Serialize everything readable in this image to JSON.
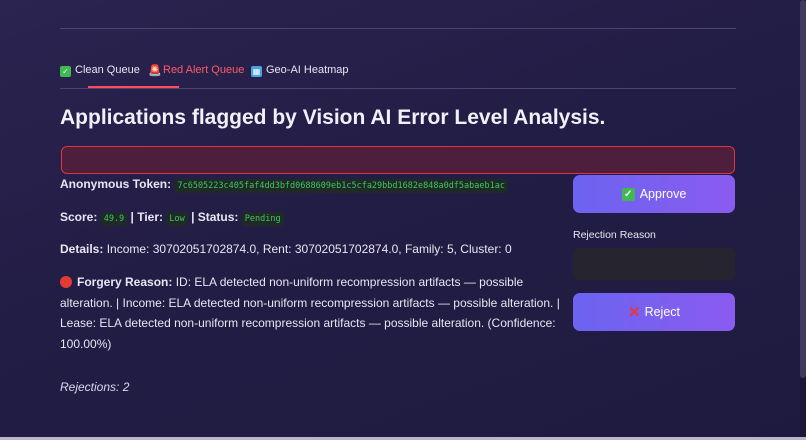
{
  "tabs": [
    {
      "label": "Clean Queue",
      "icon": "check-icon",
      "active": false
    },
    {
      "label": "Red Alert Queue",
      "icon": "siren-icon",
      "active": true
    },
    {
      "label": "Geo-AI Heatmap",
      "icon": "map-icon",
      "active": false
    }
  ],
  "page": {
    "title": "Applications flagged by Vision AI Error Level Analysis."
  },
  "record": {
    "token_label": "Anonymous Token:",
    "token_value": "7c6505223c405faf4dd3bfd0688609eb1c5cfa29bbd1682e848a0df5abaeb1ac",
    "score_label": "Score:",
    "score_value": "49.9",
    "tier_label": "| Tier:",
    "tier_value": "Low",
    "status_label": "| Status:",
    "status_value": "Pending",
    "details_label": "Details:",
    "details_value": "Income: 30702051702874.0, Rent: 30702051702874.0, Family: 5, Cluster: 0",
    "forgery_label": "Forgery Reason:",
    "forgery_value": "ID: ELA detected non-uniform recompression artifacts — possible alteration. | Income: ELA detected non-uniform recompression artifacts — possible alteration. | Lease: ELA detected non-uniform recompression artifacts — possible alteration. (Confidence: 100.00%)"
  },
  "actions": {
    "approve_label": "Approve",
    "rejection_reason_label": "Rejection Reason",
    "rejection_reason_value": "",
    "reject_label": "Reject"
  },
  "footer": {
    "rejections_text": "Rejections: 2"
  },
  "colors": {
    "accent": "#ff4b5c",
    "button": "#7a5ff0",
    "code_text": "#43c463"
  }
}
